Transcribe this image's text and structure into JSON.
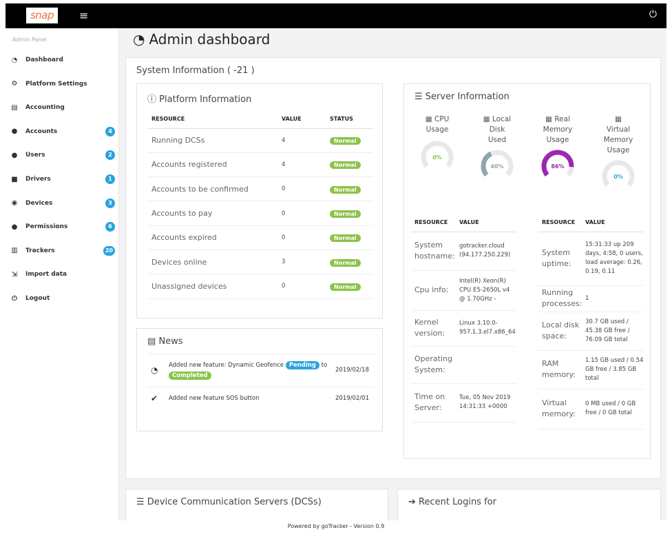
{
  "topbar": {
    "logo": "snap",
    "menu_icon": "hamburger-icon",
    "power_icon": "power-icon"
  },
  "sidebar": {
    "caption": "Admin Panel",
    "items": [
      {
        "label": "Dashboard",
        "icon": "tachometer-icon",
        "glyph": "◔"
      },
      {
        "label": "Platform Settings",
        "icon": "cogs-icon",
        "glyph": "⚙"
      },
      {
        "label": "Accounting",
        "icon": "money-icon",
        "glyph": "▤"
      },
      {
        "label": "Accounts",
        "icon": "user-icon",
        "glyph": "●",
        "badge": "4"
      },
      {
        "label": "Users",
        "icon": "users-icon",
        "glyph": "●",
        "badge": "2"
      },
      {
        "label": "Drivers",
        "icon": "car-icon",
        "glyph": "■",
        "badge": "1"
      },
      {
        "label": "Devices",
        "icon": "compass-icon",
        "glyph": "◉",
        "badge": "3"
      },
      {
        "label": "Permissions",
        "icon": "user-cog-icon",
        "glyph": "●",
        "badge": "6"
      },
      {
        "label": "Trackers",
        "icon": "microchip-icon",
        "glyph": "▥",
        "badge": "20"
      },
      {
        "label": "Import data",
        "icon": "file-import-icon",
        "glyph": "⇲"
      },
      {
        "label": "Logout",
        "icon": "power-icon",
        "glyph": "⏻"
      }
    ]
  },
  "page": {
    "title": "Admin dashboard"
  },
  "system": {
    "title": "System Information ( -21 )"
  },
  "platform": {
    "title": "Platform Information",
    "headers": [
      "RESOURCE",
      "VALUE",
      "STATUS"
    ],
    "rows": [
      {
        "resource": "Running DCSs",
        "value": "4",
        "status": "Normal"
      },
      {
        "resource": "Accounts registered",
        "value": "4",
        "status": "Normal"
      },
      {
        "resource": "Accounts to be confirmed",
        "value": "0",
        "status": "Normal"
      },
      {
        "resource": "Accounts to pay",
        "value": "0",
        "status": "Normal"
      },
      {
        "resource": "Accounts expired",
        "value": "0",
        "status": "Normal"
      },
      {
        "resource": "Devices online",
        "value": "3",
        "status": "Normal"
      },
      {
        "resource": "Unassigned devices",
        "value": "0",
        "status": "Normal"
      }
    ]
  },
  "news": {
    "title": "News",
    "items": [
      {
        "text": "Added new feature: Dynamic Geofence",
        "badge1": "Pending",
        "mid": "to",
        "badge2": "Completed",
        "date": "2019/02/18",
        "icon": "tachometer-icon"
      },
      {
        "text": "Added new feature SOS button",
        "date": "2019/02/01",
        "icon": "check-icon"
      }
    ]
  },
  "server": {
    "title": "Server Information",
    "gauges": [
      {
        "label": "CPU Usage",
        "value": 0,
        "text": "0%",
        "color": "#8bc34a",
        "icon": "hdd-icon"
      },
      {
        "label": "Local Disk Used",
        "value": 40,
        "text": "40%",
        "color": "#90a4ae",
        "icon": "hdd-icon"
      },
      {
        "label": "Real Memory Usage",
        "value": 86,
        "text": "86%",
        "color": "#9c27b0",
        "icon": "memory-icon"
      },
      {
        "label": "Virtual Memory Usage",
        "value": 0,
        "text": "0%",
        "color": "#29a3dd",
        "icon": "memory-icon"
      }
    ],
    "headers": [
      "RESOURCE",
      "VALUE"
    ],
    "left": [
      {
        "resource": "System hostname:",
        "value": "gotracker.cloud (94.177.250.229)"
      },
      {
        "resource": "Cpu info:",
        "value": "Intel(R) Xeon(R) CPU E5-2650L v4 @ 1.70GHz -"
      },
      {
        "resource": "Kernel version:",
        "value": "Linux 3.10.0-957.1.3.el7.x86_64"
      },
      {
        "resource": "Operating System:",
        "value": ""
      },
      {
        "resource": "Time on Server:",
        "value": "Tue, 05 Nov 2019 14:31:33 +0000"
      }
    ],
    "right": [
      {
        "resource": "System uptime:",
        "value": "15:31:33 up 209 days, 4:58, 0 users, load average: 0.26, 0.19, 0.11"
      },
      {
        "resource": "Running processes:",
        "value": "1"
      },
      {
        "resource": "Local disk space:",
        "value": "30.7 GB used / 45.38 GB free / 76.09 GB total"
      },
      {
        "resource": "RAM memory:",
        "value": "1.15 GB used / 0.54 GB free / 3.85 GB total"
      },
      {
        "resource": "Virtual memory:",
        "value": "0 MB used / 0 GB free / 0 GB total"
      }
    ]
  },
  "dcs": {
    "title": "Device Communication Servers (DCSs)"
  },
  "logins": {
    "title": "Recent Logins for"
  },
  "footer": "Powered by goTracker - Version 0.9"
}
